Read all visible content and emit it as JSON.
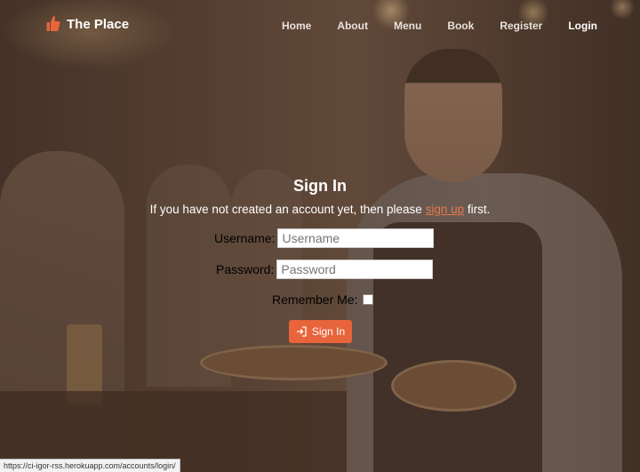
{
  "nav": {
    "brand": "The Place",
    "links": [
      "Home",
      "About",
      "Menu",
      "Book",
      "Register",
      "Login"
    ],
    "active": "Login"
  },
  "form": {
    "title": "Sign In",
    "subtitle_prefix": "If you have not created an account yet, then please ",
    "signup_link": "sign up",
    "subtitle_suffix": " first.",
    "username_label": "Username:",
    "username_placeholder": "Username",
    "password_label": "Password:",
    "password_placeholder": "Password",
    "remember_label": "Remember Me:",
    "submit_label": "Sign In"
  },
  "status_url": "https://ci-igor-rss.herokuapp.com/accounts/login/",
  "colors": {
    "accent": "#e8643b",
    "link": "#e8784e",
    "overlay": "#503728"
  },
  "icons": {
    "brand": "thumbs-up-icon",
    "submit": "sign-in-icon"
  }
}
